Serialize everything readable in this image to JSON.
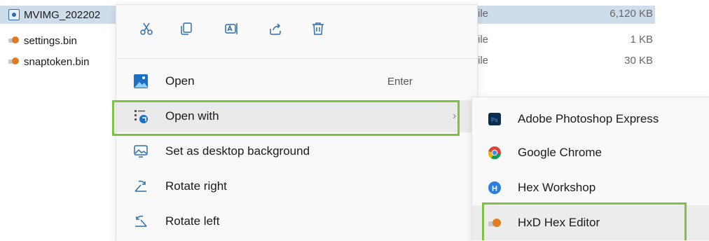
{
  "explorer": {
    "files": [
      {
        "name": "MVIMG_202202",
        "type": "File",
        "size": "6,120 KB",
        "icon": "image-file-icon",
        "selected": true
      },
      {
        "name": "settings.bin",
        "type": "File",
        "size": "1 KB",
        "icon": "bin-file-icon",
        "selected": false
      },
      {
        "name": "snaptoken.bin",
        "type": "File",
        "size": "30 KB",
        "icon": "bin-file-icon",
        "selected": false
      }
    ],
    "type_fragments": [
      "ile",
      "ile",
      "ile"
    ]
  },
  "context_menu": {
    "toolbar": [
      "cut-icon",
      "copy-icon",
      "rename-icon",
      "share-icon",
      "delete-icon"
    ],
    "items": [
      {
        "label": "Open",
        "shortcut": "Enter",
        "icon": "photos-icon"
      },
      {
        "label": "Open with",
        "shortcut": "",
        "icon": "open-with-icon"
      },
      {
        "label": "Set as desktop background",
        "shortcut": "",
        "icon": "desktop-background-icon"
      },
      {
        "label": "Rotate right",
        "shortcut": "",
        "icon": "rotate-right-icon"
      },
      {
        "label": "Rotate left",
        "shortcut": "",
        "icon": "rotate-left-icon"
      }
    ]
  },
  "open_with_submenu": {
    "items": [
      {
        "label": "Adobe Photoshop Express",
        "icon": "photoshop-express-icon"
      },
      {
        "label": "Google Chrome",
        "icon": "chrome-icon"
      },
      {
        "label": "Hex Workshop",
        "icon": "hex-workshop-icon"
      },
      {
        "label": "HxD Hex Editor",
        "icon": "hxd-icon"
      }
    ]
  },
  "colors": {
    "highlight": "#7dc242",
    "selection": "#cfdcea",
    "menu_bg": "#f9f9f9"
  }
}
